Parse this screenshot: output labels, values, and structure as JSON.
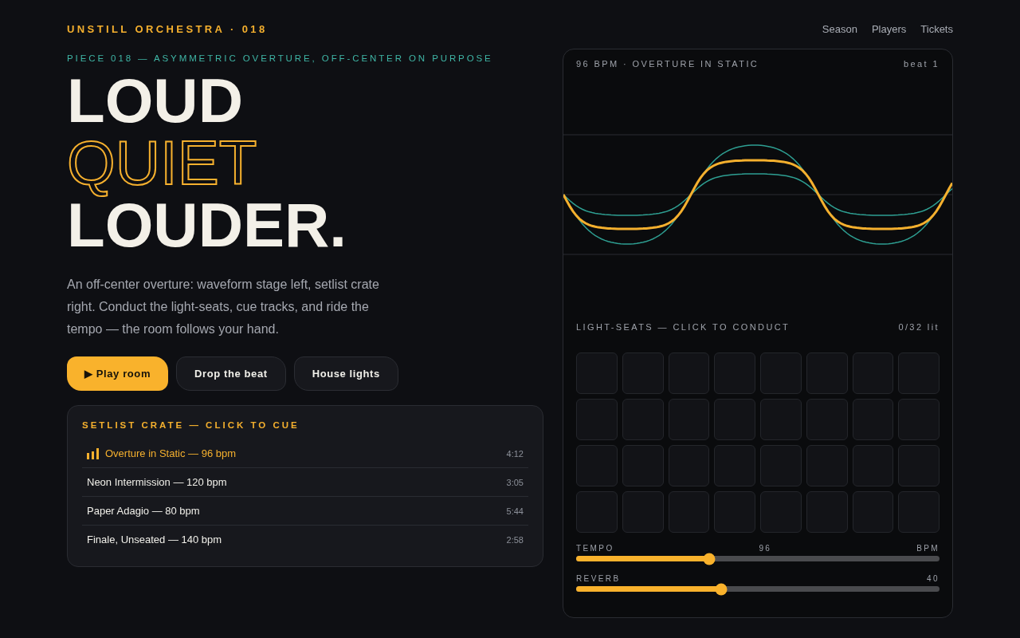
{
  "brand": "UNSTILL ORCHESTRA · 018",
  "nav": [
    {
      "label": "Season"
    },
    {
      "label": "Players"
    },
    {
      "label": "Tickets"
    }
  ],
  "eyebrow": "PIECE 018 — ASYMMETRIC OVERTURE, OFF-CENTER ON PURPOSE",
  "headline": [
    {
      "text": "LOUD",
      "kind": "solid"
    },
    {
      "text": "QUIET",
      "kind": "outline"
    },
    {
      "text": "LOUDER.",
      "kind": "solid"
    }
  ],
  "intro": "An off-center overture: waveform stage left, setlist crate right. Conduct the light-seats, cue tracks, and ride the tempo — the room follows your hand.",
  "buttons": [
    {
      "label": "▶ Play room",
      "kind": "primary"
    },
    {
      "label": "Drop the beat",
      "kind": "ghost"
    },
    {
      "label": "House lights",
      "kind": "ghost"
    }
  ],
  "setlist": {
    "title": "SETLIST CRATE — CLICK TO CUE",
    "tracks": [
      {
        "title": "Overture in Static — 96 bpm",
        "duration": "4:12",
        "selected": true
      },
      {
        "title": "Neon Intermission — 120 bpm",
        "duration": "3:05",
        "selected": false
      },
      {
        "title": "Paper Adagio — 80 bpm",
        "duration": "5:44",
        "selected": false
      },
      {
        "title": "Finale, Unseated — 140 bpm",
        "duration": "2:58",
        "selected": false
      }
    ]
  },
  "stage": {
    "caption": "96 BPM · OVERTURE IN STATIC",
    "beat": "beat 1"
  },
  "seats": {
    "title": "LIGHT-SEATS — CLICK TO CONDUCT",
    "count": "0/32 lit",
    "items": [
      {
        "lit": false
      },
      {
        "lit": false
      },
      {
        "lit": false
      },
      {
        "lit": false
      },
      {
        "lit": false
      },
      {
        "lit": false
      },
      {
        "lit": false
      },
      {
        "lit": false
      },
      {
        "lit": false
      },
      {
        "lit": false
      },
      {
        "lit": false
      },
      {
        "lit": false
      },
      {
        "lit": false
      },
      {
        "lit": false
      },
      {
        "lit": false
      },
      {
        "lit": false
      },
      {
        "lit": false
      },
      {
        "lit": false
      },
      {
        "lit": false
      },
      {
        "lit": false
      },
      {
        "lit": false
      },
      {
        "lit": false
      },
      {
        "lit": false
      },
      {
        "lit": false
      },
      {
        "lit": false
      },
      {
        "lit": false
      },
      {
        "lit": false
      },
      {
        "lit": false
      },
      {
        "lit": false
      },
      {
        "lit": false
      },
      {
        "lit": false
      },
      {
        "lit": false
      }
    ]
  },
  "sliders": [
    {
      "label": "TEMPO",
      "reading": "96",
      "unit": "BPM",
      "level": 0.366
    },
    {
      "label": "REVERB",
      "reading": "40",
      "level": 0.4
    }
  ]
}
